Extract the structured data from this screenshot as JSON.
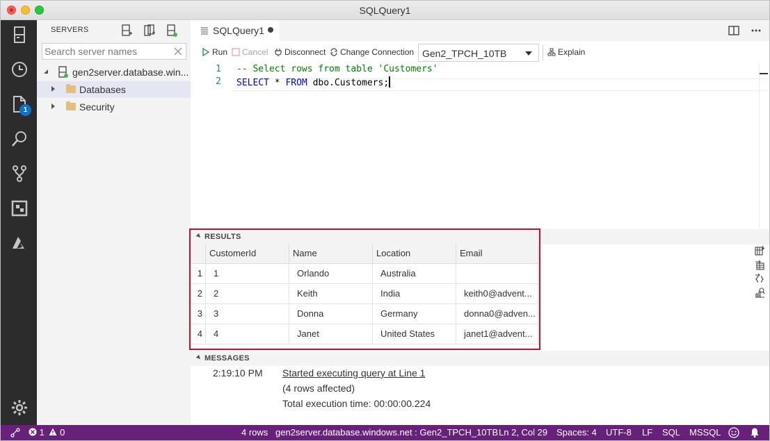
{
  "window": {
    "title": "SQLQuery1"
  },
  "activity_bar": {
    "items": [
      "servers-icon",
      "history-icon",
      "explorer-icon",
      "search-icon",
      "source-control-icon",
      "extensions-icon",
      "azure-icon",
      "settings-icon"
    ],
    "explorer_badge": "1"
  },
  "sidebar": {
    "title": "SERVERS",
    "search_placeholder": "Search server names",
    "tree": {
      "server": "gen2server.database.win...",
      "children": [
        "Databases",
        "Security"
      ]
    }
  },
  "editor": {
    "tab": {
      "label": "SQLQuery1"
    },
    "toolbar": {
      "run": "Run",
      "cancel": "Cancel",
      "disconnect": "Disconnect",
      "change_connection": "Change Connection",
      "database": "Gen2_TPCH_10TB",
      "explain": "Explain"
    },
    "code": {
      "line_numbers": [
        "1",
        "2"
      ],
      "line1": "-- Select rows from table 'Customers'",
      "line2_kw1": "SELECT",
      "line2_op": " * ",
      "line2_kw2": "FROM",
      "line2_rest": " dbo.Customers;"
    }
  },
  "results": {
    "title": "RESULTS",
    "columns": [
      "CustomerId",
      "Name",
      "Location",
      "Email"
    ],
    "rows": [
      {
        "num": "1",
        "id": "1",
        "name": "Orlando",
        "location": "Australia",
        "email": ""
      },
      {
        "num": "2",
        "id": "2",
        "name": "Keith",
        "location": "India",
        "email": "keith0@advent..."
      },
      {
        "num": "3",
        "id": "3",
        "name": "Donna",
        "location": "Germany",
        "email": "donna0@adven..."
      },
      {
        "num": "4",
        "id": "4",
        "name": "Janet",
        "location": "United States",
        "email": "janet1@advent..."
      }
    ]
  },
  "messages": {
    "title": "MESSAGES",
    "time": "2:19:10 PM",
    "link": "Started executing query at Line 1",
    "affected": "(4 rows affected)",
    "exec_time": "Total execution time: 00:00:00.224"
  },
  "statusbar": {
    "errors": "1",
    "warnings": "0",
    "rows": "4 rows",
    "connection": "gen2server.database.windows.net : Gen2_TPCH_10TB",
    "position": "Ln 2, Col 29",
    "spaces": "Spaces: 4",
    "encoding": "UTF-8",
    "eol": "LF",
    "language": "SQL",
    "provider": "MSSQL"
  },
  "colors": {
    "statusbar": "#68217a",
    "activity_bar": "#2c2c2c",
    "highlight_box": "#c8102e",
    "badge": "#0e72c6"
  }
}
